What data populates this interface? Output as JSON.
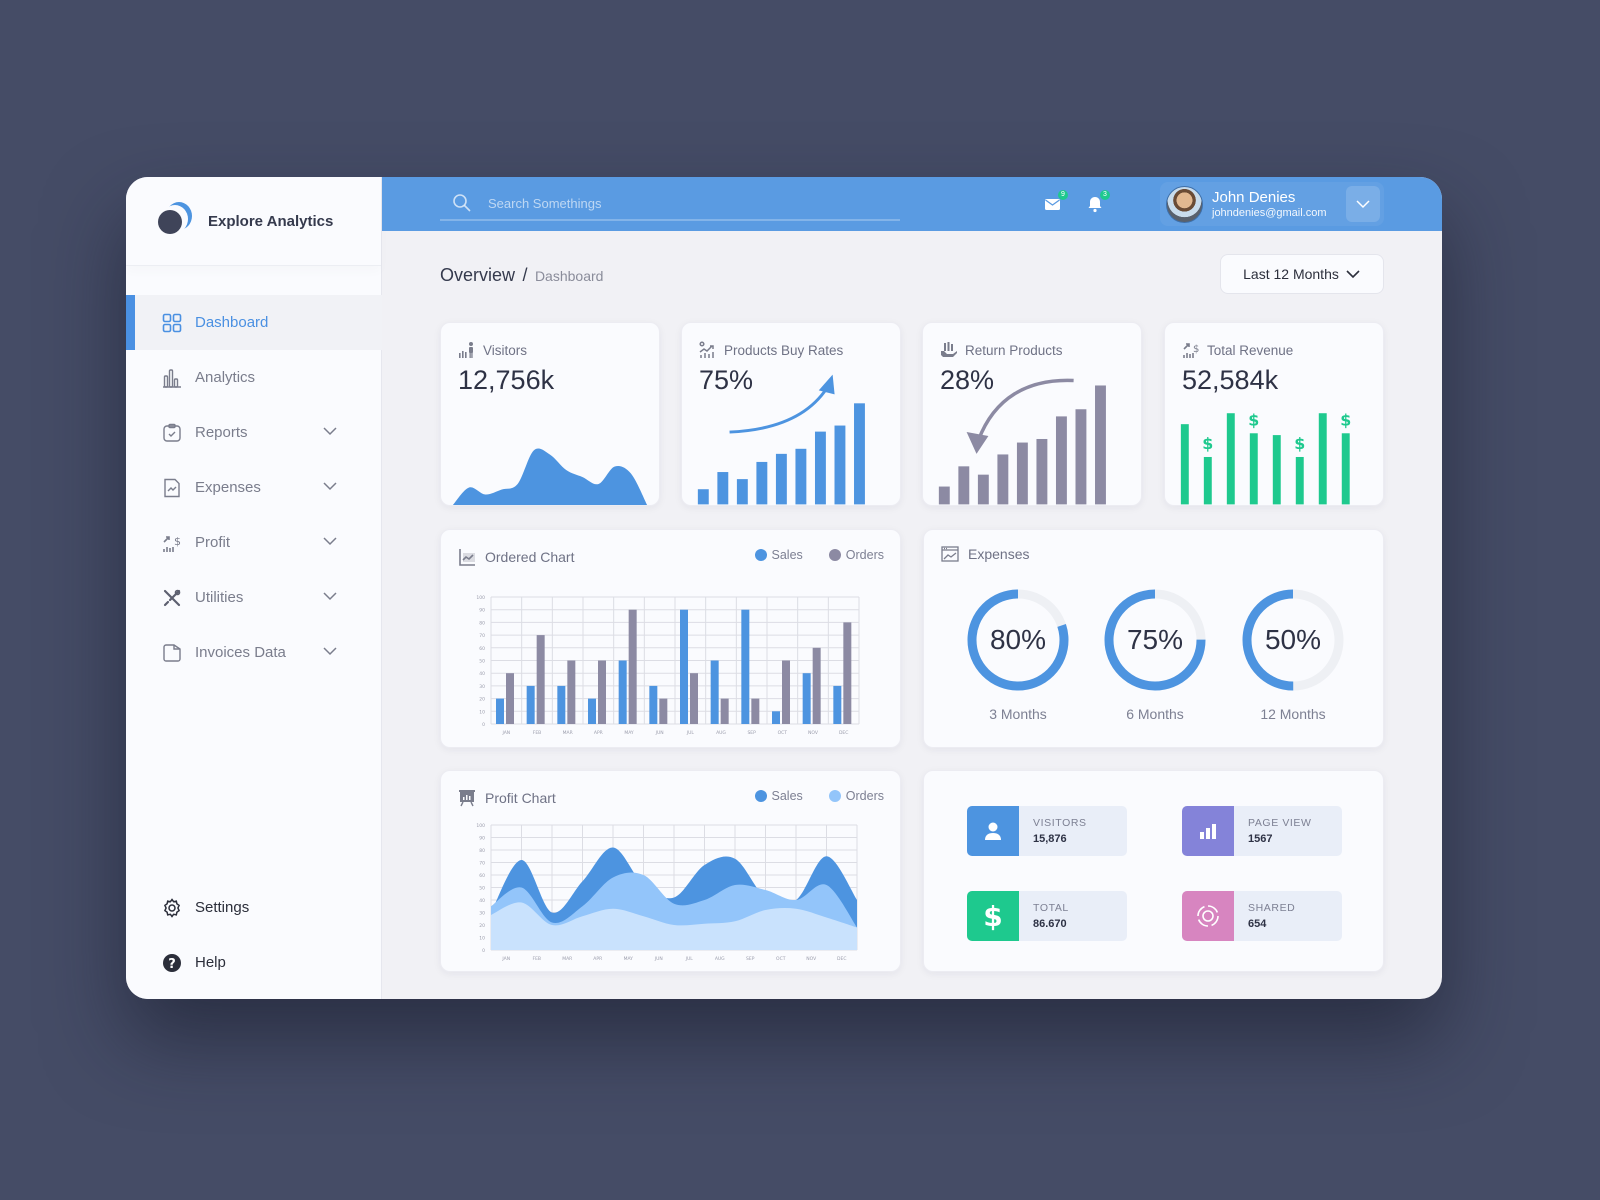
{
  "app": {
    "name": "Explore Analytics"
  },
  "sidebar": {
    "items": [
      {
        "label": "Dashboard",
        "icon": "grid-icon",
        "active": true,
        "has_children": false
      },
      {
        "label": "Analytics",
        "icon": "bar-chart-icon",
        "active": false,
        "has_children": false
      },
      {
        "label": "Reports",
        "icon": "clipboard-check-icon",
        "active": false,
        "has_children": true
      },
      {
        "label": "Expenses",
        "icon": "document-chart-icon",
        "active": false,
        "has_children": true
      },
      {
        "label": "Profit",
        "icon": "profit-chart-icon",
        "active": false,
        "has_children": true
      },
      {
        "label": "Utilities",
        "icon": "tools-icon",
        "active": false,
        "has_children": true
      },
      {
        "label": "Invoices Data",
        "icon": "folder-icon",
        "active": false,
        "has_children": true
      }
    ],
    "bottom": [
      {
        "label": "Settings",
        "icon": "gear-icon"
      },
      {
        "label": "Help",
        "icon": "help-icon"
      }
    ]
  },
  "topbar": {
    "search_placeholder": "Search Somethings",
    "mail_badge": "9",
    "notification_badge": "3",
    "user": {
      "name": "John Denies",
      "email": "johndenies@gmail.com"
    }
  },
  "header": {
    "title": "Overview",
    "separator": "/",
    "subtitle": "Dashboard",
    "period": "Last 12 Months"
  },
  "kpis": [
    {
      "title": "Visitors",
      "value": "12,756k",
      "icon": "visitors-icon"
    },
    {
      "title": "Products Buy Rates",
      "value": "75%",
      "icon": "growth-icon"
    },
    {
      "title": "Return Products",
      "value": "28%",
      "icon": "return-icon"
    },
    {
      "title": "Total Revenue",
      "value": "52,584k",
      "icon": "revenue-icon"
    }
  ],
  "colors": {
    "accent": "#5a9be2",
    "blue": "#4d94e0",
    "gray": "#8c8aa3",
    "green": "#1ec98e",
    "light_blue": "#93c5fa",
    "pale_blue": "#c9e2fd",
    "purple": "#8483d9",
    "pink": "#d785c0"
  },
  "ordered_chart": {
    "title": "Ordered Chart",
    "legend": [
      "Sales",
      "Orders"
    ]
  },
  "profit_chart": {
    "title": "Profit Chart",
    "legend": [
      "Sales",
      "Orders"
    ]
  },
  "expenses": {
    "title": "Expenses",
    "items": [
      {
        "label": "80%",
        "value": 80,
        "caption": "3 Months"
      },
      {
        "label": "75%",
        "value": 75,
        "caption": "6 Months"
      },
      {
        "label": "50%",
        "value": 50,
        "caption": "12 Months"
      }
    ]
  },
  "stats": [
    {
      "label": "VISITORS",
      "value": "15,876",
      "icon": "user-icon",
      "color": "#4d94e0"
    },
    {
      "label": "PAGE VIEW",
      "value": "1567",
      "icon": "bars-icon",
      "color": "#8483d9"
    },
    {
      "label": "TOTAL",
      "value": "86.670",
      "icon": "dollar-icon",
      "color": "#1ec98e"
    },
    {
      "label": "SHARED",
      "value": "654",
      "icon": "share-icon",
      "color": "#d785c0"
    }
  ],
  "chart_data": [
    {
      "type": "bar",
      "title": "Ordered Chart",
      "categories": [
        "JAN",
        "FEB",
        "MAR",
        "APR",
        "MAY",
        "JUN",
        "JUL",
        "AUG",
        "SEP",
        "OCT",
        "NOV",
        "DEC"
      ],
      "series": [
        {
          "name": "Sales",
          "values": [
            20,
            30,
            30,
            20,
            50,
            30,
            90,
            50,
            90,
            10,
            40,
            30
          ]
        },
        {
          "name": "Orders",
          "values": [
            40,
            70,
            50,
            50,
            90,
            20,
            40,
            20,
            20,
            50,
            60,
            80
          ]
        }
      ],
      "yticks": [
        0,
        10,
        20,
        30,
        40,
        50,
        60,
        70,
        80,
        90,
        100
      ],
      "ylim": [
        0,
        100
      ],
      "grid": true,
      "legend": "top-right"
    },
    {
      "type": "area",
      "title": "Profit Chart",
      "categories": [
        "JAN",
        "FEB",
        "MAR",
        "APR",
        "MAY",
        "JUN",
        "JUL",
        "AUG",
        "SEP",
        "OCT",
        "NOV",
        "DEC"
      ],
      "series": [
        {
          "name": "Sales",
          "values": [
            30,
            72,
            30,
            55,
            82,
            52,
            42,
            68,
            73,
            42,
            40,
            75,
            40
          ]
        },
        {
          "name": "Orders",
          "values": [
            35,
            50,
            22,
            35,
            58,
            60,
            37,
            40,
            52,
            48,
            40,
            52,
            18
          ]
        },
        {
          "name": "Base",
          "values": [
            28,
            38,
            20,
            27,
            33,
            27,
            20,
            21,
            23,
            32,
            33,
            26,
            18
          ]
        }
      ],
      "yticks": [
        0,
        10,
        20,
        30,
        40,
        50,
        60,
        70,
        80,
        90,
        100
      ],
      "ylim": [
        0,
        100
      ],
      "grid": true,
      "legend": "top-right"
    },
    {
      "type": "area",
      "title": "Visitors",
      "values": [
        10,
        25,
        15,
        22,
        30,
        78,
        72,
        50,
        40,
        30,
        55,
        45,
        10
      ]
    },
    {
      "type": "bar",
      "title": "Products Buy Rates",
      "values": [
        15,
        32,
        25,
        42,
        50,
        55,
        72,
        78,
        100
      ]
    },
    {
      "type": "bar",
      "title": "Return Products",
      "values": [
        15,
        32,
        25,
        42,
        52,
        55,
        74,
        80,
        100
      ]
    },
    {
      "type": "bar",
      "title": "Total Revenue",
      "values": [
        88,
        52,
        100,
        78,
        76,
        52,
        100,
        78
      ],
      "dollar_marks": [
        1,
        3,
        5,
        7
      ]
    }
  ]
}
